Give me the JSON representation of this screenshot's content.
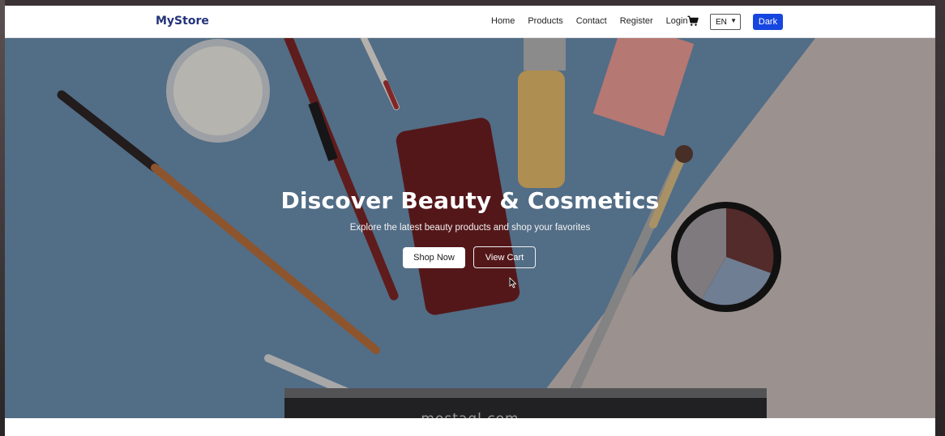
{
  "navbar": {
    "brand": "MyStore",
    "links": [
      {
        "label": "Home"
      },
      {
        "label": "Products"
      },
      {
        "label": "Contact"
      },
      {
        "label": "Register"
      },
      {
        "label": "Login"
      }
    ],
    "cart_icon": "shopping-cart-icon",
    "language": {
      "selected": "EN"
    },
    "theme_toggle_label": "Dark",
    "theme_toggle_color": "#1646e0"
  },
  "hero": {
    "title": "Discover Beauty & Cosmetics",
    "subtitle": "Explore the latest beauty products and shop your favorites",
    "primary_button": "Shop Now",
    "secondary_button": "View Cart",
    "background_color": "#5b7c9c",
    "watermark": "mostaql.com"
  }
}
